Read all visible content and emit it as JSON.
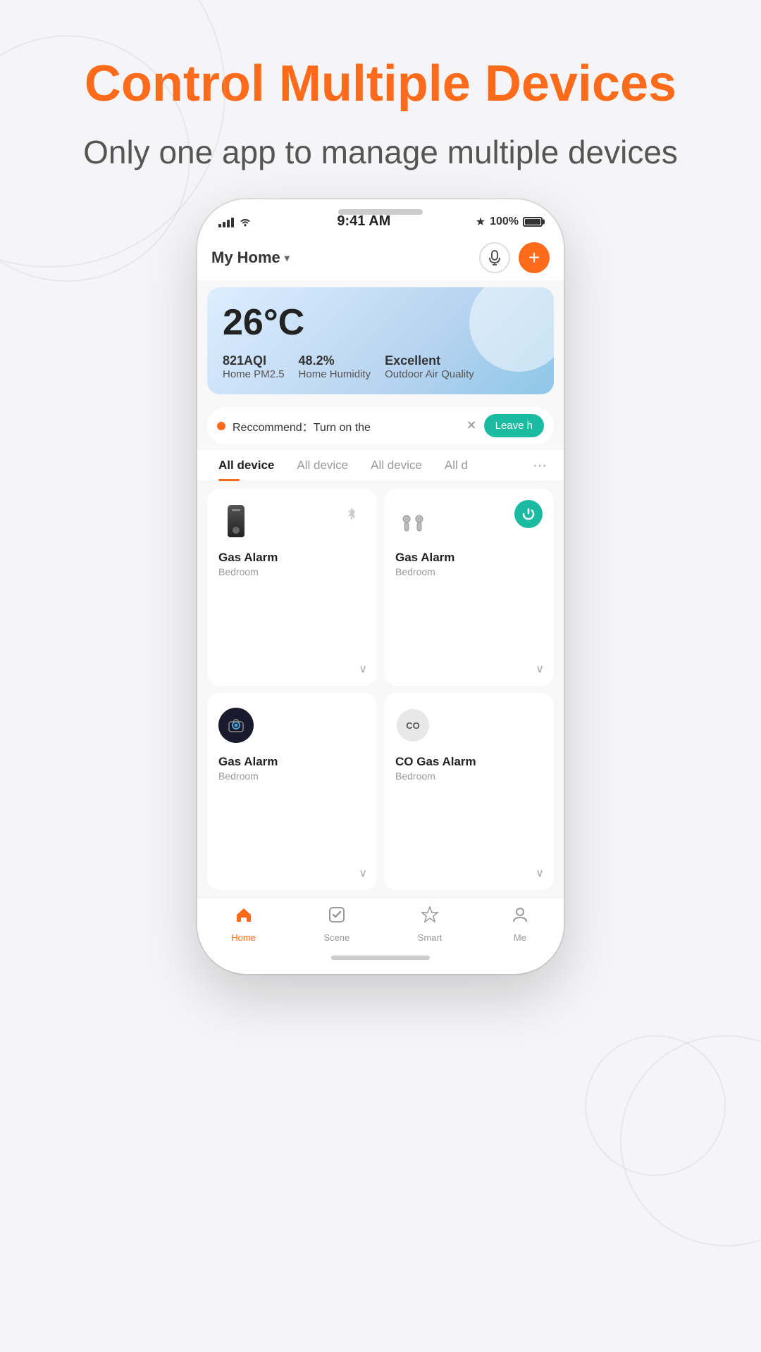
{
  "page": {
    "title": "Control Multiple Devices",
    "subtitle": "Only one app to manage multiple devices",
    "background_color": "#f5f5f7"
  },
  "phone": {
    "status_bar": {
      "time": "9:41 AM",
      "battery": "100%",
      "signal": "full",
      "wifi": true,
      "bluetooth": true
    },
    "header": {
      "home_name": "My Home",
      "mic_label": "mic",
      "add_label": "add"
    },
    "weather": {
      "temperature": "26°C",
      "aqi_value": "821AQI",
      "aqi_label": "Home PM2.5",
      "humidity_value": "48.2%",
      "humidity_label": "Home Humidity",
      "air_quality_value": "Excellent",
      "air_quality_label": "Outdoor Air Quality"
    },
    "recommendation": {
      "text": "Reccommend：Turn on the",
      "action": "Leave h"
    },
    "tabs": [
      {
        "label": "All device",
        "active": true
      },
      {
        "label": "All device",
        "active": false
      },
      {
        "label": "All device",
        "active": false
      },
      {
        "label": "All d",
        "active": false
      }
    ],
    "devices": [
      {
        "name": "Gas Alarm",
        "room": "Bedroom",
        "type": "gas_device",
        "status": "off"
      },
      {
        "name": "Gas Alarm",
        "room": "Bedroom",
        "type": "airpods",
        "status": "on"
      },
      {
        "name": "Gas Alarm",
        "room": "Bedroom",
        "type": "camera",
        "status": "off"
      },
      {
        "name": "CO Gas Alarm",
        "room": "Bedroom",
        "type": "co_sensor",
        "status": "off"
      }
    ],
    "bottom_nav": [
      {
        "label": "Home",
        "icon": "home",
        "active": true
      },
      {
        "label": "Scene",
        "icon": "scene",
        "active": false
      },
      {
        "label": "Smart",
        "icon": "smart",
        "active": false
      },
      {
        "label": "Me",
        "icon": "me",
        "active": false
      }
    ]
  }
}
